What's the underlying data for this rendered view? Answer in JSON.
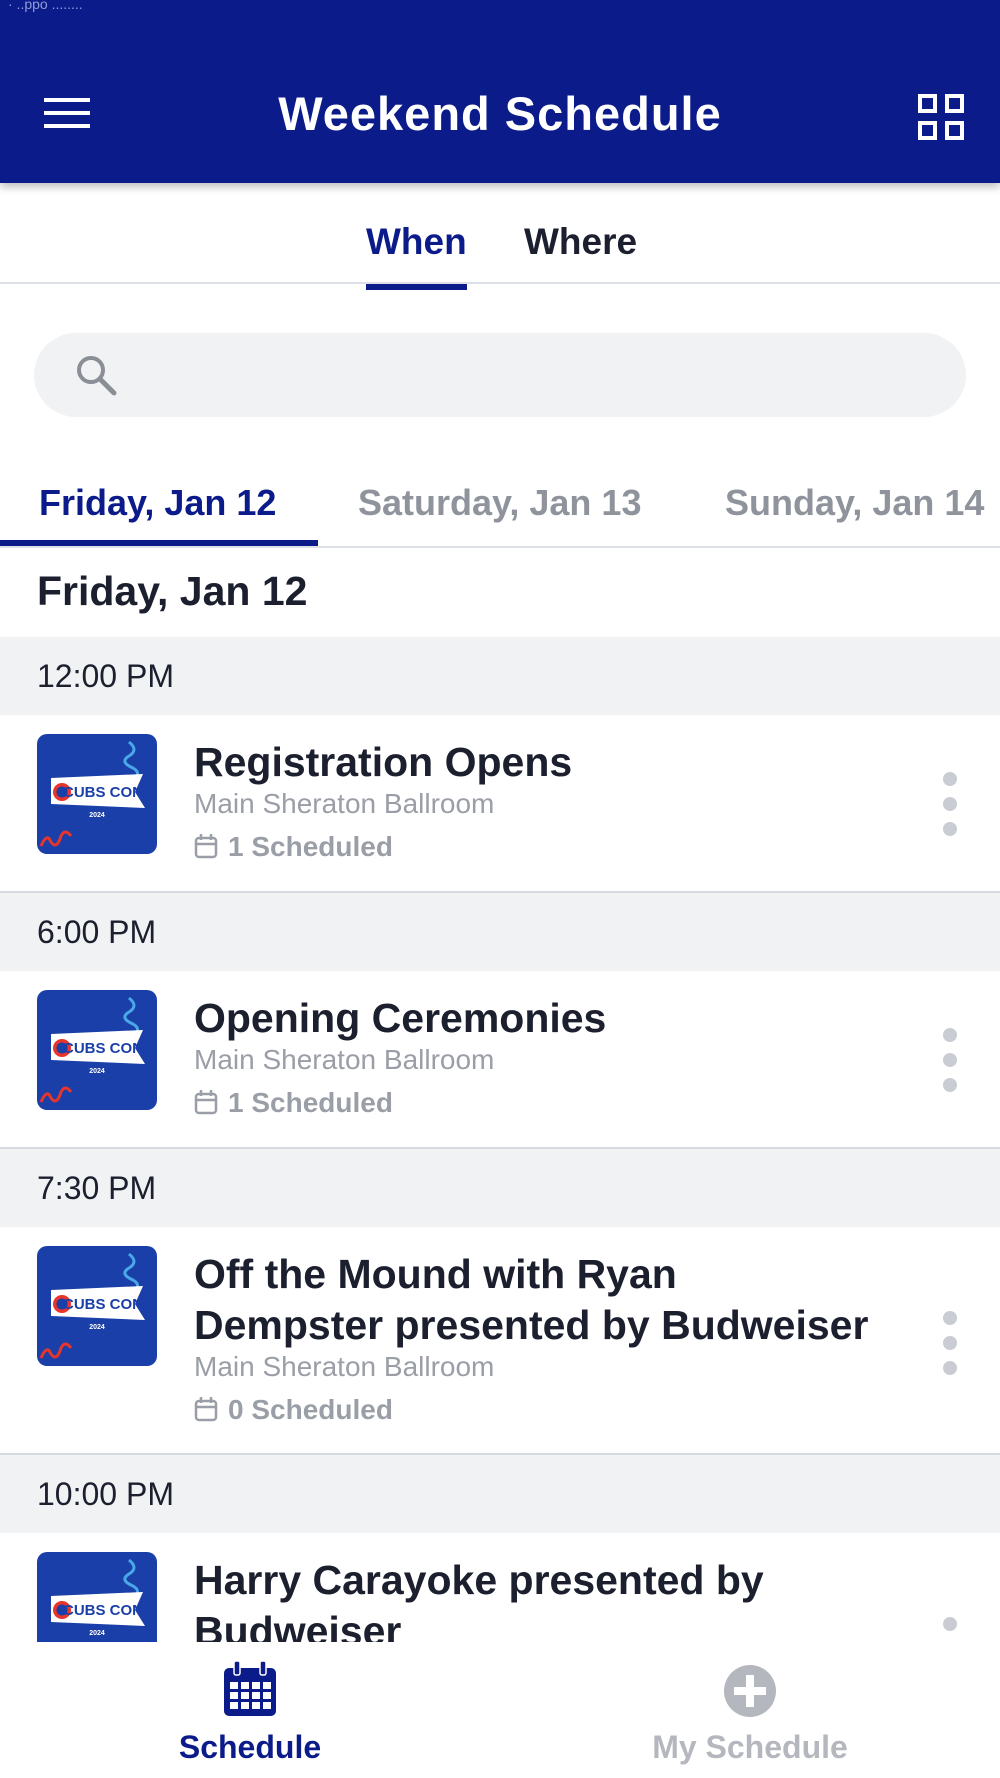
{
  "header": {
    "status_fragment": "· ..ppo ........",
    "title": "Weekend Schedule"
  },
  "view_tabs": [
    {
      "label": "When",
      "active": true
    },
    {
      "label": "Where",
      "active": false
    }
  ],
  "search": {
    "placeholder": ""
  },
  "day_tabs": [
    {
      "label": "Friday, Jan 12",
      "active": true
    },
    {
      "label": "Saturday, Jan 13",
      "active": false
    },
    {
      "label": "Sunday, Jan 14",
      "active": false
    }
  ],
  "day_heading": "Friday, Jan 12",
  "groups": [
    {
      "time": "12:00 PM",
      "event": {
        "title_lines": [
          "Registration Opens"
        ],
        "location": "Main Sheraton Ballroom",
        "scheduled": "1 Scheduled",
        "logo_text": "CUBS CON",
        "logo_year": "2024"
      }
    },
    {
      "time": "6:00 PM",
      "event": {
        "title_lines": [
          "Opening Ceremonies"
        ],
        "location": "Main Sheraton Ballroom",
        "scheduled": "1 Scheduled",
        "logo_text": "CUBS CON",
        "logo_year": "2024"
      }
    },
    {
      "time": "7:30 PM",
      "event": {
        "title_lines": [
          "Off the Mound with Ryan",
          "Dempster presented by Budweiser"
        ],
        "location": "Main Sheraton Ballroom",
        "scheduled": "0 Scheduled",
        "logo_text": "CUBS CON",
        "logo_year": "2024"
      }
    },
    {
      "time": "10:00 PM",
      "event": {
        "title_lines": [
          "Harry Carayoke presented by",
          "Budweiser"
        ],
        "location": "",
        "scheduled": "",
        "logo_text": "CUBS CON",
        "logo_year": "2024"
      }
    }
  ],
  "bottom_nav": [
    {
      "label": "Schedule",
      "icon": "calendar-icon",
      "active": true
    },
    {
      "label": "My Schedule",
      "icon": "add-circle-icon",
      "active": false
    }
  ],
  "colors": {
    "brand_blue": "#0c1b8a",
    "muted_text": "#9a9ea6",
    "time_band": "#f1f2f4",
    "logo_red": "#e8352b",
    "logo_light_blue": "#4aa8e8"
  }
}
